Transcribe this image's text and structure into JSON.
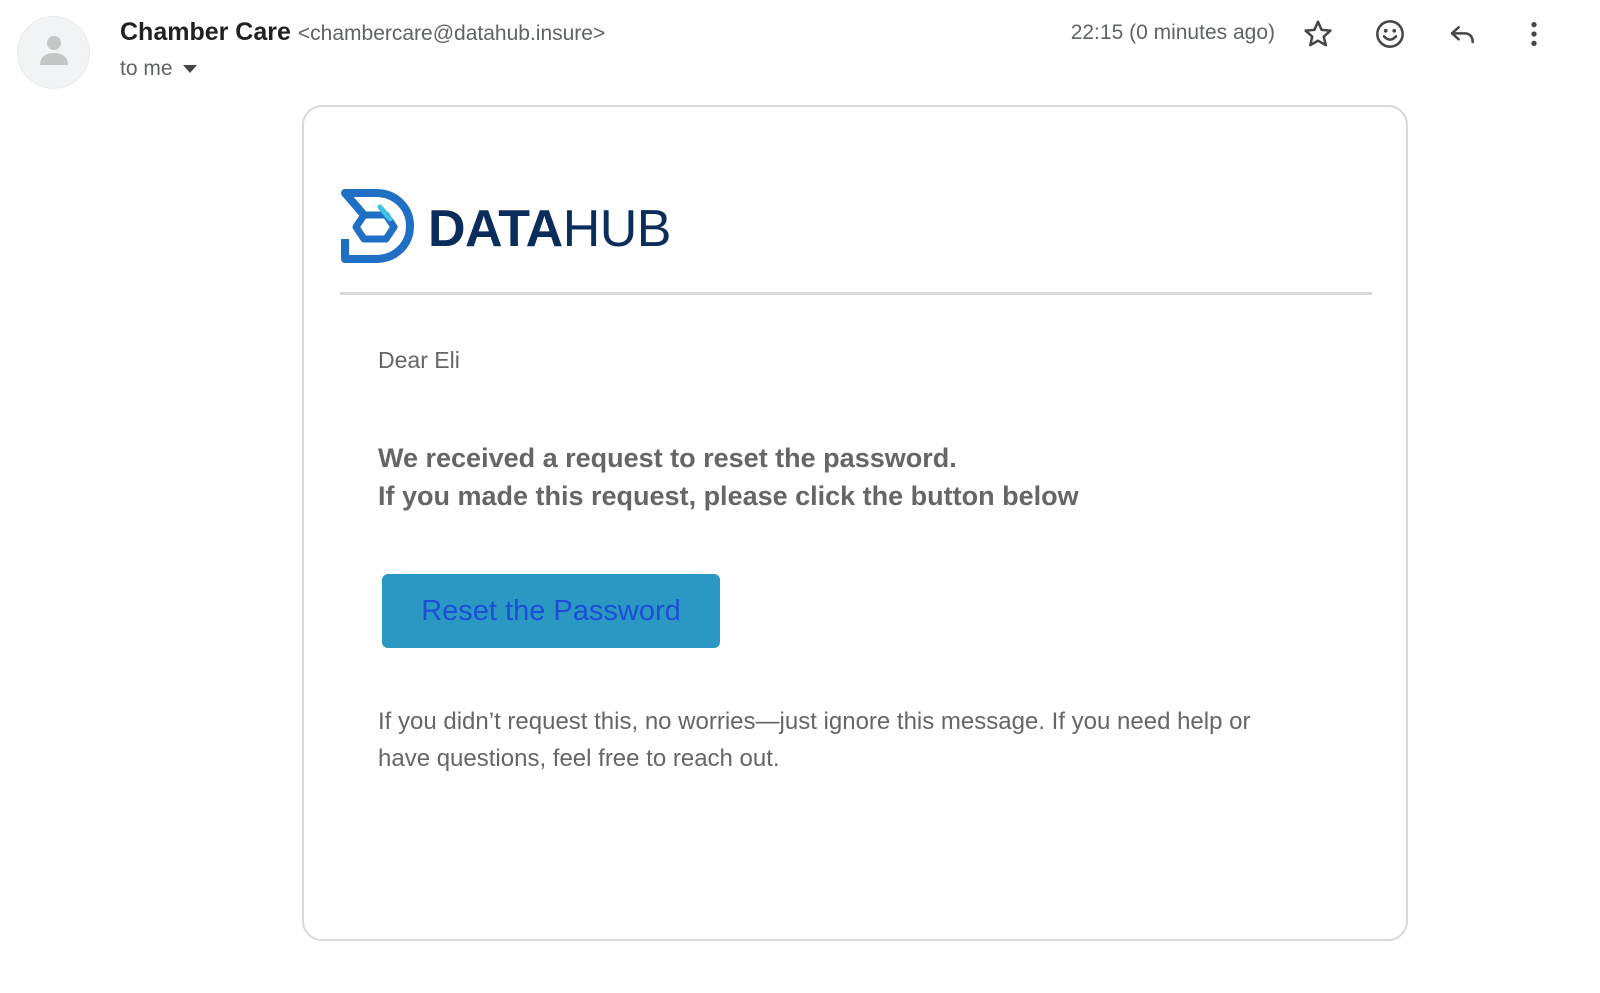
{
  "sender": {
    "name": "Chamber Care",
    "email": "<chambercare@datahub.insure>",
    "recipient_label": "to me"
  },
  "timestamp": "22:15 (0 minutes ago)",
  "actions": {
    "star_icon": "star-icon",
    "emoji_icon": "emoji-icon",
    "reply_icon": "reply-icon",
    "more_icon": "more-vertical-icon"
  },
  "email_body": {
    "logo": {
      "bold_part": "DATA",
      "regular_part": "HUB",
      "color": "#0a2d5c",
      "mark_color": "#1f6fc4"
    },
    "greeting": "Dear Eli",
    "headline_line1": "We received a request to reset the password.",
    "headline_line2": "If you made this request, please click the button below",
    "button_label": "Reset the Password",
    "button_color": "#2a98c3",
    "footer_line1": "If you didn’t request this, no worries—just ignore this message. If you need help or",
    "footer_line2": "have questions, feel free to reach out."
  }
}
